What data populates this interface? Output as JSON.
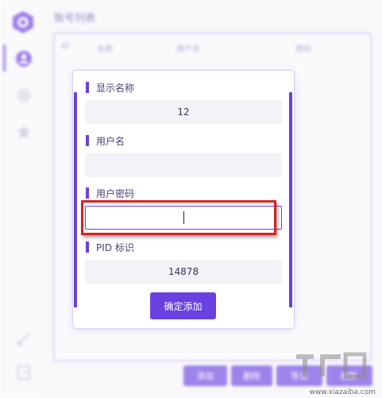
{
  "page": {
    "title": "账号列表",
    "columns": [
      "ID",
      "名称",
      "用户名",
      "密码"
    ]
  },
  "sidebar": {
    "items": [
      {
        "icon": "user-icon",
        "active": true
      },
      {
        "icon": "gear-icon",
        "active": false
      },
      {
        "icon": "star-icon",
        "active": false
      }
    ],
    "bottom_icons": [
      "collapse-icon",
      "exit-icon"
    ]
  },
  "toolbar": {
    "add_label": "添加",
    "delete_label": "删除",
    "btn3_label": "导出",
    "btn4_label": "刷新"
  },
  "dialog": {
    "fields": [
      {
        "label": "显示名称",
        "value": "12"
      },
      {
        "label": "用户名",
        "value": ""
      },
      {
        "label": "用户密码",
        "value": ""
      },
      {
        "label": "PID 标识",
        "value": "14878"
      }
    ],
    "confirm_label": "确定添加"
  },
  "watermark": {
    "text": "www.xiazaiba.com"
  },
  "colors": {
    "accent": "#6a41e0",
    "highlight": "#d92020"
  }
}
